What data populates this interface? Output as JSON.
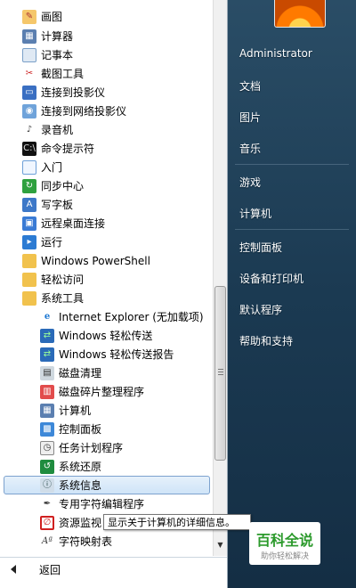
{
  "programs": [
    {
      "label": "画图",
      "icon": "paint-icon",
      "level": 0
    },
    {
      "label": "计算器",
      "icon": "calculator-icon",
      "level": 0
    },
    {
      "label": "记事本",
      "icon": "notepad-icon",
      "level": 0
    },
    {
      "label": "截图工具",
      "icon": "snipping-tool-icon",
      "level": 0
    },
    {
      "label": "连接到投影仪",
      "icon": "projector-icon",
      "level": 0
    },
    {
      "label": "连接到网络投影仪",
      "icon": "network-projector-icon",
      "level": 0
    },
    {
      "label": "录音机",
      "icon": "microphone-icon",
      "level": 0
    },
    {
      "label": "命令提示符",
      "icon": "command-prompt-icon",
      "level": 0
    },
    {
      "label": "入门",
      "icon": "getting-started-icon",
      "level": 0
    },
    {
      "label": "同步中心",
      "icon": "sync-center-icon",
      "level": 0
    },
    {
      "label": "写字板",
      "icon": "wordpad-icon",
      "level": 0
    },
    {
      "label": "远程桌面连接",
      "icon": "remote-desktop-icon",
      "level": 0
    },
    {
      "label": "运行",
      "icon": "run-icon",
      "level": 0
    },
    {
      "label": "Windows PowerShell",
      "icon": "folder-icon",
      "level": 0
    },
    {
      "label": "轻松访问",
      "icon": "folder-icon",
      "level": 0
    },
    {
      "label": "系统工具",
      "icon": "folder-icon",
      "level": 0
    },
    {
      "label": "Internet Explorer (无加载项)",
      "icon": "internet-explorer-icon",
      "level": 1
    },
    {
      "label": "Windows 轻松传送",
      "icon": "easy-transfer-icon",
      "level": 1
    },
    {
      "label": "Windows 轻松传送报告",
      "icon": "easy-transfer-report-icon",
      "level": 1
    },
    {
      "label": "磁盘清理",
      "icon": "disk-cleanup-icon",
      "level": 1
    },
    {
      "label": "磁盘碎片整理程序",
      "icon": "disk-defragmenter-icon",
      "level": 1
    },
    {
      "label": "计算机",
      "icon": "computer-icon",
      "level": 1
    },
    {
      "label": "控制面板",
      "icon": "control-panel-icon",
      "level": 1
    },
    {
      "label": "任务计划程序",
      "icon": "task-scheduler-icon",
      "level": 1
    },
    {
      "label": "系统还原",
      "icon": "system-restore-icon",
      "level": 1
    },
    {
      "label": "系统信息",
      "icon": "system-information-icon",
      "level": 1,
      "selected": true
    },
    {
      "label": "专用字符编辑程序",
      "icon": "private-character-editor-icon",
      "level": 1
    },
    {
      "label": "资源监视",
      "icon": "resource-monitor-icon",
      "level": 1
    },
    {
      "label": "字符映射表",
      "icon": "character-map-icon",
      "level": 1
    }
  ],
  "back_label": "返回",
  "tooltip": "显示关于计算机的详细信息。",
  "right_menu": {
    "user": "Administrator",
    "documents": "文档",
    "pictures": "图片",
    "music": "音乐",
    "games": "游戏",
    "computer": "计算机",
    "control_panel": "控制面板",
    "devices_printers": "设备和打印机",
    "default_programs": "默认程序",
    "help_support": "帮助和支持"
  },
  "watermark": {
    "title": "百科全说",
    "subtitle": "助你轻松解决"
  },
  "colors": {
    "selection": "#cfe4f8",
    "right_pane": "#1b3a52",
    "watermark_green": "#2c9a2c"
  }
}
